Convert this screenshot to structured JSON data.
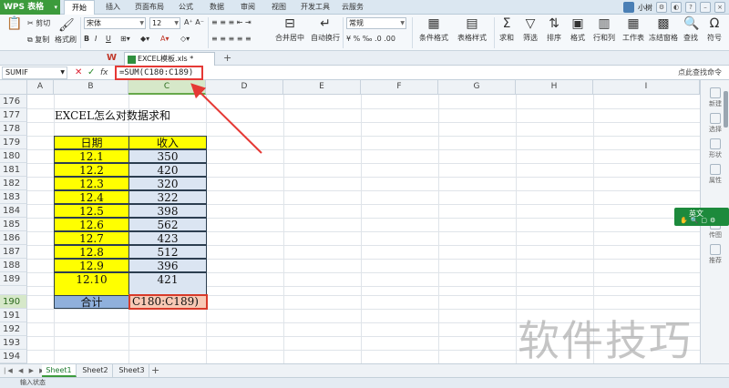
{
  "app": {
    "logo": "WPS 表格",
    "user": "小树"
  },
  "menu": {
    "tabs": [
      "开始",
      "插入",
      "页面布局",
      "公式",
      "数据",
      "审阅",
      "视图",
      "开发工具",
      "云服务"
    ]
  },
  "ribbon": {
    "cut": "剪切",
    "copy": "复制",
    "format_painter": "格式刷",
    "font": "宋体",
    "font_size": "12",
    "merge_center": "合并居中",
    "wrap": "自动换行",
    "number_format": "常规",
    "cond_format": "条件格式",
    "table_style": "表格样式",
    "sum": "求和",
    "filter": "筛选",
    "sort": "排序",
    "format": "格式",
    "row_col": "行和列",
    "worksheet": "工作表",
    "freeze": "冻结窗格",
    "find": "查找",
    "symbol": "符号"
  },
  "file_tab": {
    "name": "EXCEL模板.xls *"
  },
  "formula_bar": {
    "name_box": "SUMIF",
    "formula": "=SUM(C180:C189)",
    "right_tip": "点此查找命令"
  },
  "grid": {
    "columns": [
      "A",
      "B",
      "C",
      "D",
      "E",
      "F",
      "G",
      "H",
      "I"
    ],
    "rows": [
      "176",
      "177",
      "178",
      "179",
      "180",
      "181",
      "182",
      "183",
      "184",
      "185",
      "186",
      "187",
      "188",
      "189",
      "190",
      "191",
      "192",
      "193",
      "194"
    ],
    "title": "EXCEL怎么对数据求和",
    "headers": {
      "date": "日期",
      "income": "收入"
    },
    "dates": [
      "12.1",
      "12.2",
      "12.3",
      "12.4",
      "12.5",
      "12.6",
      "12.7",
      "12.8",
      "12.9",
      "12.10"
    ],
    "incomes": [
      "350",
      "420",
      "320",
      "322",
      "398",
      "562",
      "423",
      "512",
      "396",
      "421"
    ],
    "total_label": "合计",
    "active_cell_text": "C180:C189)"
  },
  "side_panel": {
    "items": [
      "新建",
      "选择",
      "形状",
      "属性",
      "传图",
      "推荐"
    ]
  },
  "ime": {
    "label": "英文"
  },
  "sheets": {
    "tabs": [
      "Sheet1",
      "Sheet2",
      "Sheet3"
    ],
    "add": "+"
  },
  "status": {
    "text": "输入状态"
  },
  "watermark": "软件技巧",
  "colors": {
    "accent": "#3c9b3c",
    "highlight": "#e53935",
    "yellow": "#ffff00",
    "cell_blue": "#dbe5f2"
  }
}
